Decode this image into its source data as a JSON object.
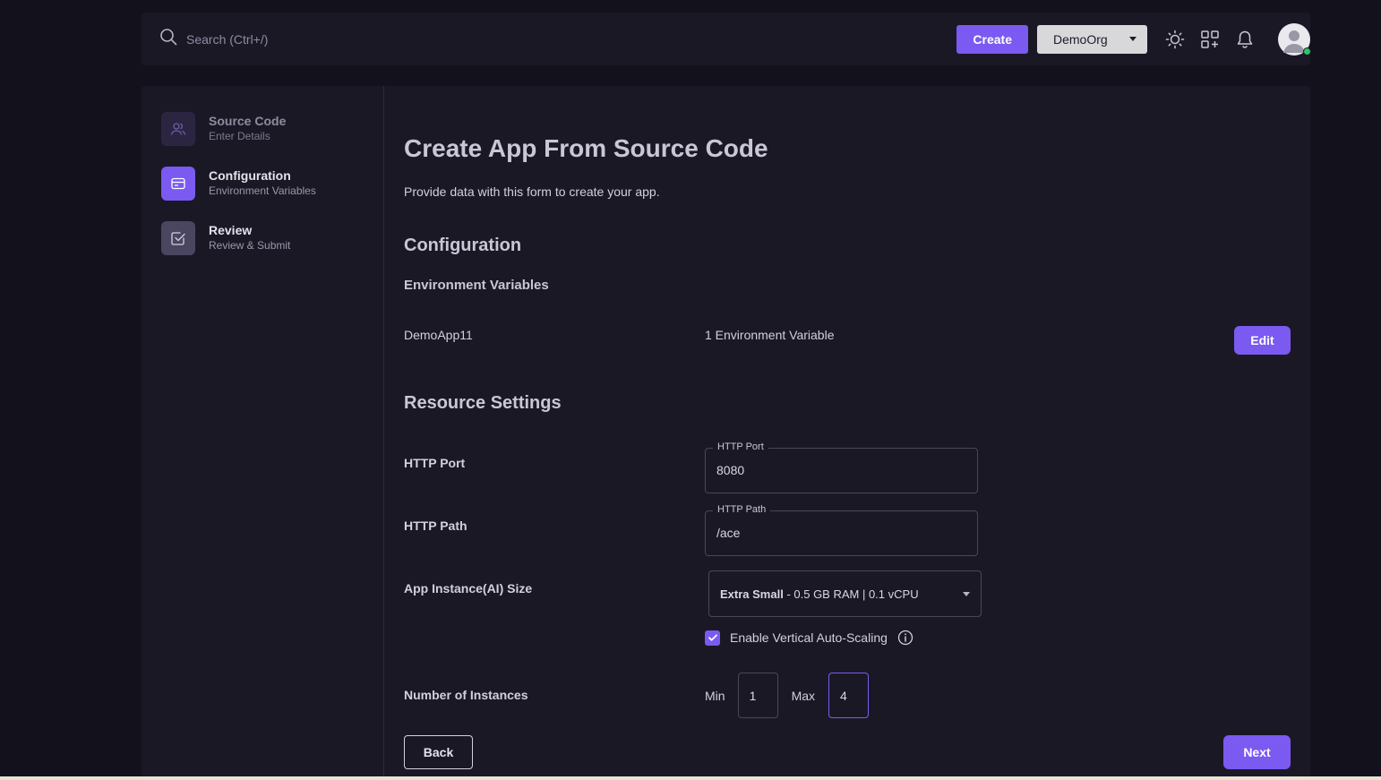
{
  "header": {
    "search_placeholder": "Search (Ctrl+/)",
    "create_label": "Create",
    "org_name": "DemoOrg",
    "icons": [
      "search-icon",
      "sun-icon",
      "apps-grid-icon",
      "bell-icon",
      "avatar"
    ]
  },
  "stepper": [
    {
      "title": "Source Code",
      "subtitle": "Enter Details",
      "state": "completed",
      "icon": "users-icon"
    },
    {
      "title": "Configuration",
      "subtitle": "Environment Variables",
      "state": "active",
      "icon": "card-icon"
    },
    {
      "title": "Review",
      "subtitle": "Review & Submit",
      "state": "pending",
      "icon": "check-square-icon"
    }
  ],
  "page": {
    "title": "Create App From Source Code",
    "description": "Provide data with this form to create your app."
  },
  "configuration": {
    "heading": "Configuration",
    "env_heading": "Environment Variables",
    "app_name": "DemoApp11",
    "env_count": "1 Environment Variable",
    "edit_label": "Edit"
  },
  "resources": {
    "heading": "Resource Settings",
    "http_port": {
      "label": "HTTP Port",
      "legend": "HTTP Port",
      "value": "8080"
    },
    "http_path": {
      "label": "HTTP Path",
      "legend": "HTTP Path",
      "value": "/ace"
    },
    "instance_size": {
      "label": "App Instance(AI) Size",
      "size_name": "Extra Small",
      "size_detail": " - 0.5 GB RAM | 0.1 vCPU"
    },
    "autoscaling": {
      "label": "Enable Vertical Auto-Scaling",
      "checked": true
    },
    "instances": {
      "label": "Number of Instances",
      "min_label": "Min",
      "min_value": "1",
      "max_label": "Max",
      "max_value": "4"
    }
  },
  "actions": {
    "back_label": "Back",
    "next_label": "Next"
  },
  "colors": {
    "accent": "#7a5af0",
    "background": "#13111c",
    "panel": "#1b1826"
  }
}
